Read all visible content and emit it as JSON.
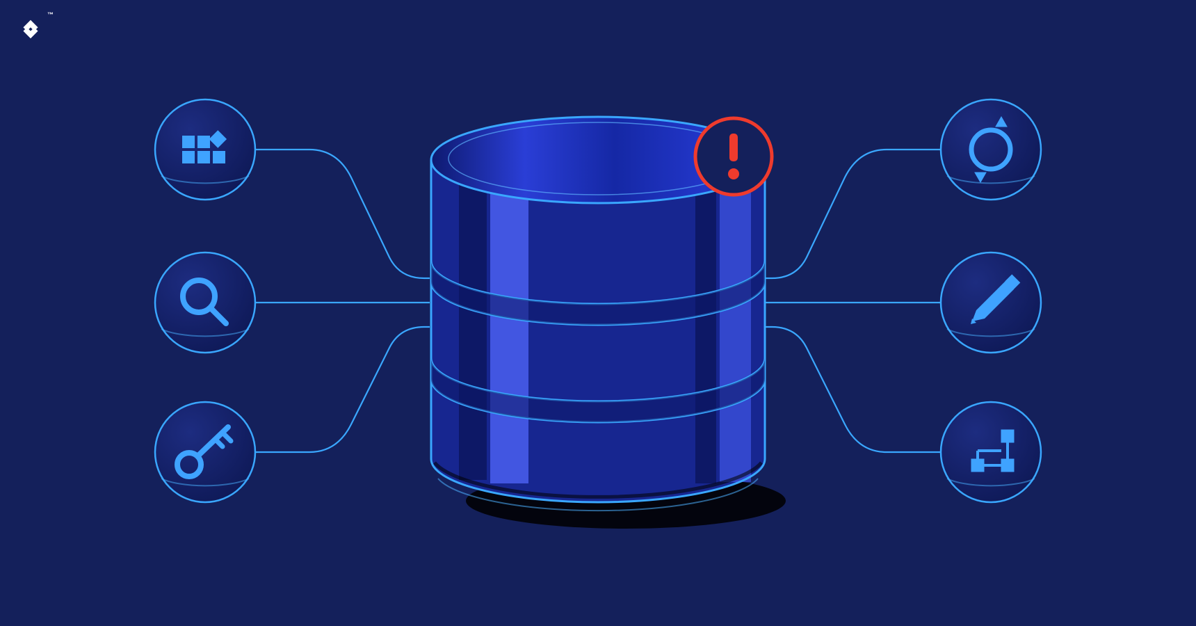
{
  "brand": {
    "trademark_label": "™",
    "logo_name": "toptal-logo"
  },
  "colors": {
    "background": "#14205b",
    "cylinder_fill": "#1a2fb4",
    "cylinder_dark": "#0f1a63",
    "cylinder_highlight": "#3e53e0",
    "stroke_light": "#3aa7ff",
    "icon_blue": "#3fa3ff",
    "circle_fill": "#16236a",
    "alert_red": "#ef3b2d",
    "shadow": "#000000"
  },
  "central": {
    "object": "database-cylinder",
    "alert": "exclamation-warning"
  },
  "icons": {
    "left": [
      {
        "name": "grid-tiles-icon",
        "semantic": "data-tiles"
      },
      {
        "name": "search-icon",
        "semantic": "search"
      },
      {
        "name": "key-icon",
        "semantic": "access-key"
      }
    ],
    "right": [
      {
        "name": "refresh-icon",
        "semantic": "sync"
      },
      {
        "name": "pencil-icon",
        "semantic": "edit"
      },
      {
        "name": "schema-icon",
        "semantic": "schema-diagram"
      }
    ]
  }
}
